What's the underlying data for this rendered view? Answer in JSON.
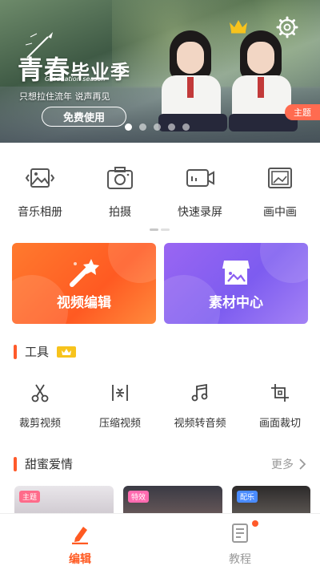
{
  "banner": {
    "title_a": "青春",
    "title_b": "毕业季",
    "english": "Graduation season",
    "subtitle": "只想拉住流年 说声再见",
    "cta": "免费使用",
    "theme_tag": "主题",
    "dots": 5,
    "active_dot": 0
  },
  "quick_actions": [
    {
      "label": "音乐相册",
      "icon": "photo-album-icon"
    },
    {
      "label": "拍摄",
      "icon": "camera-icon"
    },
    {
      "label": "快速录屏",
      "icon": "screen-record-icon"
    },
    {
      "label": "画中画",
      "icon": "picture-in-picture-icon"
    }
  ],
  "cards": {
    "video_edit": "视频编辑",
    "material_center": "素材中心"
  },
  "tools_section": {
    "title": "工具",
    "items": [
      {
        "label": "裁剪视频",
        "icon": "scissors-icon"
      },
      {
        "label": "压缩视频",
        "icon": "compress-icon"
      },
      {
        "label": "视频转音频",
        "icon": "music-note-icon"
      },
      {
        "label": "画面裁切",
        "icon": "crop-icon"
      }
    ]
  },
  "sweet_section": {
    "title": "甜蜜爱情",
    "more": "更多",
    "thumbs": [
      {
        "tag": "主题",
        "tag_color": "#ff6b8a"
      },
      {
        "tag": "特效",
        "tag_color": "#ff6bb0"
      },
      {
        "tag": "配乐",
        "tag_color": "#4a8cff"
      }
    ]
  },
  "bottom_nav": {
    "edit": "编辑",
    "tutorial": "教程"
  },
  "colors": {
    "accent": "#ff5a22",
    "card_orange": "#ff6a28",
    "card_purple": "#8b5ef2"
  }
}
